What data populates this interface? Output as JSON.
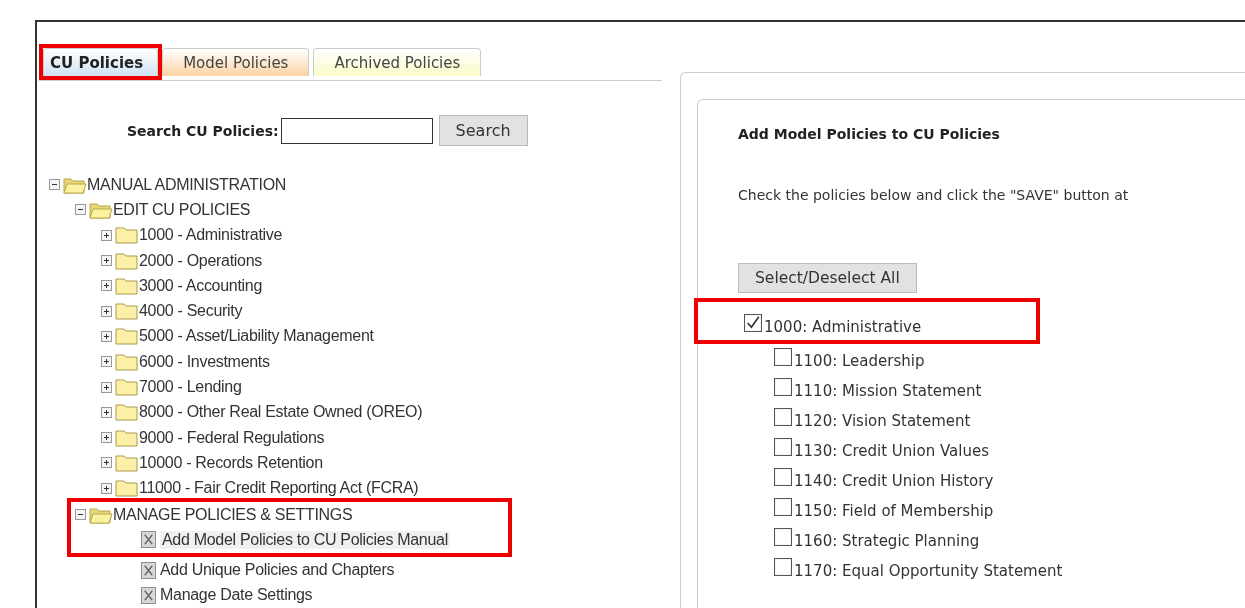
{
  "tabs": [
    {
      "label": "CU Policies",
      "selected": true,
      "color": "#cfe3f3",
      "highlighted": true
    },
    {
      "label": "Model Policies",
      "selected": false,
      "color": "#fbd3a3",
      "highlighted": false
    },
    {
      "label": "Archived Policies",
      "selected": false,
      "color": "#fbfbc8",
      "highlighted": false
    }
  ],
  "search": {
    "label": "Search CU Policies:",
    "button": "Search"
  },
  "tree": [
    {
      "label": "MANUAL ADMINISTRATION",
      "kind": "folder",
      "expanded": true,
      "highlighted": false,
      "children": [
        {
          "label": "EDIT CU POLICIES",
          "kind": "folder",
          "expanded": true,
          "highlighted": false,
          "children": [
            {
              "label": "1000 - Administrative",
              "kind": "folder",
              "expanded": false,
              "highlighted": false
            },
            {
              "label": "2000 - Operations",
              "kind": "folder",
              "expanded": false,
              "highlighted": false
            },
            {
              "label": "3000 - Accounting",
              "kind": "folder",
              "expanded": false,
              "highlighted": false
            },
            {
              "label": "4000 - Security",
              "kind": "folder",
              "expanded": false,
              "highlighted": false
            },
            {
              "label": "5000 - Asset/Liability Management",
              "kind": "folder",
              "expanded": false,
              "highlighted": false
            },
            {
              "label": "6000 - Investments",
              "kind": "folder",
              "expanded": false,
              "highlighted": false
            },
            {
              "label": "7000 - Lending",
              "kind": "folder",
              "expanded": false,
              "highlighted": false
            },
            {
              "label": "8000 - Other Real Estate Owned (OREO)",
              "kind": "folder",
              "expanded": false,
              "highlighted": false
            },
            {
              "label": "9000 - Federal Regulations",
              "kind": "folder",
              "expanded": false,
              "highlighted": false
            },
            {
              "label": "10000 - Records Retention",
              "kind": "folder",
              "expanded": false,
              "highlighted": false
            },
            {
              "label": "11000 - Fair Credit Reporting Act (FCRA)",
              "kind": "folder",
              "expanded": false,
              "highlighted": false
            }
          ]
        },
        {
          "label": "MANAGE POLICIES & SETTINGS",
          "kind": "folder",
          "expanded": true,
          "highlighted": true,
          "children": [
            {
              "label": "Add Model Policies to CU Policies Manual",
              "kind": "page",
              "highlighted": true,
              "selected": true
            },
            {
              "label": "Add Unique Policies and Chapters",
              "kind": "page",
              "highlighted": false,
              "selected": false
            },
            {
              "label": "Manage Date Settings",
              "kind": "page",
              "highlighted": false,
              "selected": false
            }
          ]
        }
      ]
    }
  ],
  "panel": {
    "title": "Add Model Policies to CU Policies",
    "instructions": "Check the policies below and click the \"SAVE\" button at",
    "select_all": "Select/Deselect All"
  },
  "policies": [
    {
      "label": "1000: Administrative",
      "checked": true,
      "highlighted": true,
      "children": [
        {
          "label": "1100: Leadership",
          "checked": false
        },
        {
          "label": "1110: Mission Statement",
          "checked": false
        },
        {
          "label": "1120: Vision Statement",
          "checked": false
        },
        {
          "label": "1130: Credit Union Values",
          "checked": false
        },
        {
          "label": "1140: Credit Union History",
          "checked": false
        },
        {
          "label": "1150: Field of Membership",
          "checked": false
        },
        {
          "label": "1160: Strategic Planning",
          "checked": false
        },
        {
          "label": "1170: Equal Opportunity Statement",
          "checked": false
        }
      ]
    }
  ]
}
